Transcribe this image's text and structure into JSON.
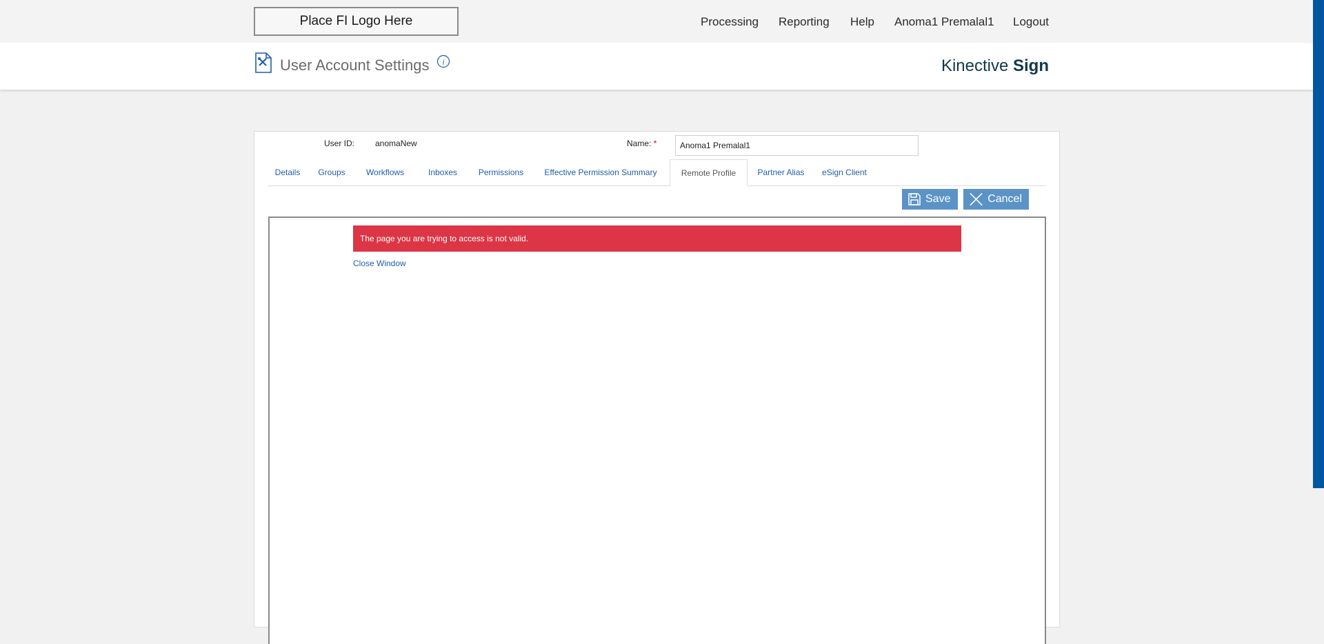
{
  "topbar": {
    "logo_text": "Place FI Logo Here",
    "nav": [
      "Processing",
      "Reporting",
      "Help",
      "Anoma1 Premalal1",
      "Logout"
    ]
  },
  "header": {
    "title": "User Account Settings",
    "brand_light": "Kinective",
    "brand_bold": "Sign"
  },
  "form": {
    "user_id_label": "User ID:",
    "user_id_value": "anomaNew",
    "name_label": "Name:",
    "required_mark": "*",
    "name_value": "Anoma1 Premalal1"
  },
  "tabs": [
    {
      "label": "Details"
    },
    {
      "label": "Groups"
    },
    {
      "label": "Workflows"
    },
    {
      "label": "Inboxes"
    },
    {
      "label": "Permissions"
    },
    {
      "label": "Effective Permission Summary"
    },
    {
      "label": "Remote Profile",
      "active": true
    },
    {
      "label": "Partner Alias"
    },
    {
      "label": "eSign Client"
    }
  ],
  "actions": {
    "save_label": "Save",
    "cancel_label": "Cancel"
  },
  "content": {
    "error_message": "The page you are trying to access is not valid.",
    "close_link": "Close Window"
  },
  "colors": {
    "accent": "#0057a0",
    "button": "#5b93c7",
    "error": "#dc3545",
    "link": "#1f5fa6"
  }
}
